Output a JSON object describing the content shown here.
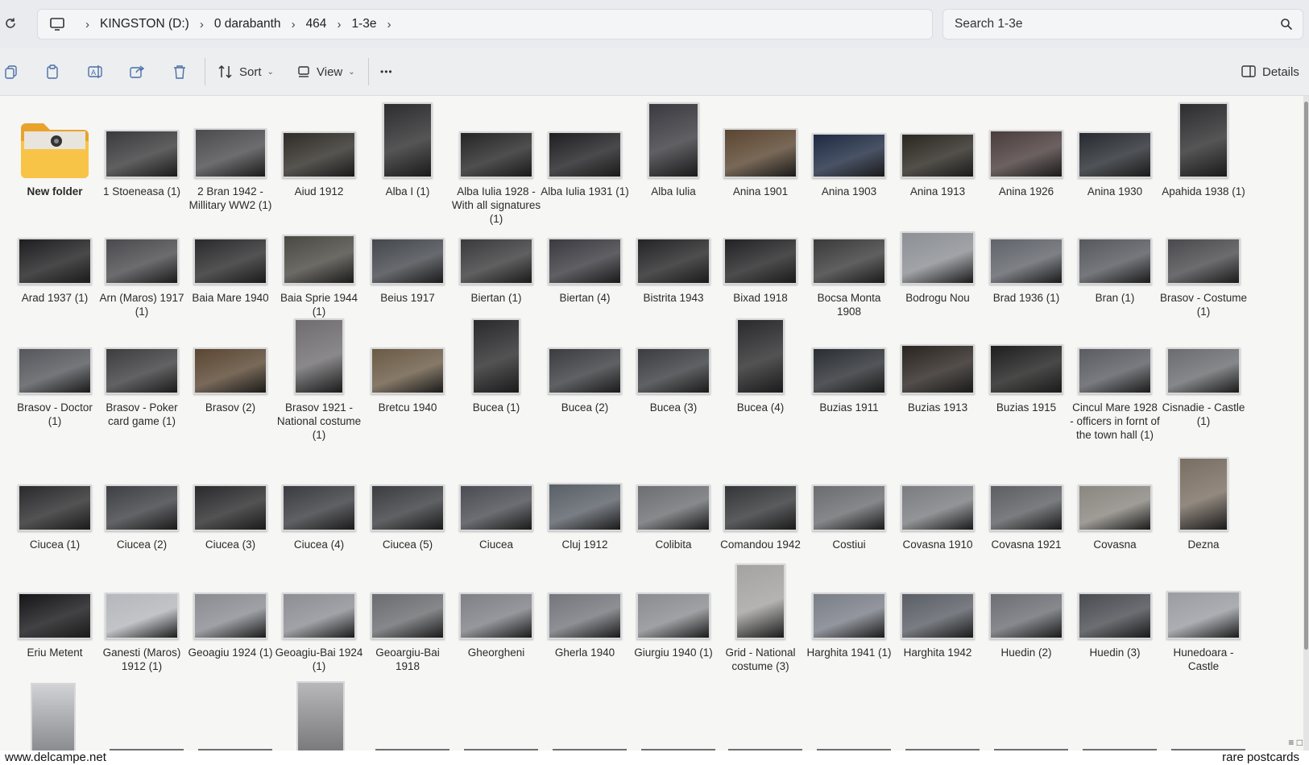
{
  "address_bar": {
    "breadcrumbs": [
      "KINGSTON (D:)",
      "0 darabanth",
      "464",
      "1-3e"
    ],
    "search_placeholder": "Search 1-3e"
  },
  "toolbar": {
    "sort_label": "Sort",
    "view_label": "View",
    "more_label": "•••",
    "details_label": "Details"
  },
  "items": [
    "New folder",
    "1 Stoeneasa (1)",
    "2 Bran 1942 - Millitary WW2 (1)",
    "Aiud 1912",
    "Alba I (1)",
    "Alba Iulia 1928 - With all signatures (1)",
    "Alba Iulia 1931 (1)",
    "Alba Iulia",
    "Anina 1901",
    "Anina 1903",
    "Anina 1913",
    "Anina 1926",
    "Anina 1930",
    "Apahida 1938 (1)",
    "Arad 1937 (1)",
    "Arn (Maros) 1917 (1)",
    "Baia Mare 1940",
    "Baia Sprie 1944 (1)",
    "Beius 1917",
    "Biertan (1)",
    "Biertan (4)",
    "Bistrita 1943",
    "Bixad 1918",
    "Bocsa Monta 1908",
    "Bodrogu Nou",
    "Brad 1936 (1)",
    "Bran (1)",
    "Brasov - Costume  (1)",
    "Brasov - Doctor (1)",
    "Brasov - Poker card game (1)",
    "Brasov (2)",
    "Brasov 1921 - National costume (1)",
    "Bretcu 1940",
    "Bucea (1)",
    "Bucea (2)",
    "Bucea (3)",
    "Bucea (4)",
    "Buzias 1911",
    "Buzias 1913",
    "Buzias 1915",
    "Cincul Mare 1928 - officers in fornt of the town hall (1)",
    "Cisnadie - Castle (1)",
    "Ciucea (1)",
    "Ciucea (2)",
    "Ciucea (3)",
    "Ciucea (4)",
    "Ciucea (5)",
    "Ciucea",
    "Cluj 1912",
    "Colibita",
    "Comandou 1942",
    "Costiui",
    "Covasna 1910",
    "Covasna 1921",
    "Covasna",
    "Dezna",
    "Eriu Metent",
    "Ganesti (Maros) 1912 (1)",
    "Geoagiu 1924 (1)",
    "Geoagiu-Bai 1924 (1)",
    "Geoargiu-Bai 1918",
    "Gheorgheni",
    "Gherla 1940",
    "Giurgiu 1940 (1)",
    "Grid - National costume (3)",
    "Harghita 1941 (1)",
    "Harghita 1942",
    "Huedin (2)",
    "Huedin (3)",
    "Hunedoara - Castle"
  ],
  "watermark": {
    "left": "www.delcampe.net",
    "right": "rare postcards"
  }
}
